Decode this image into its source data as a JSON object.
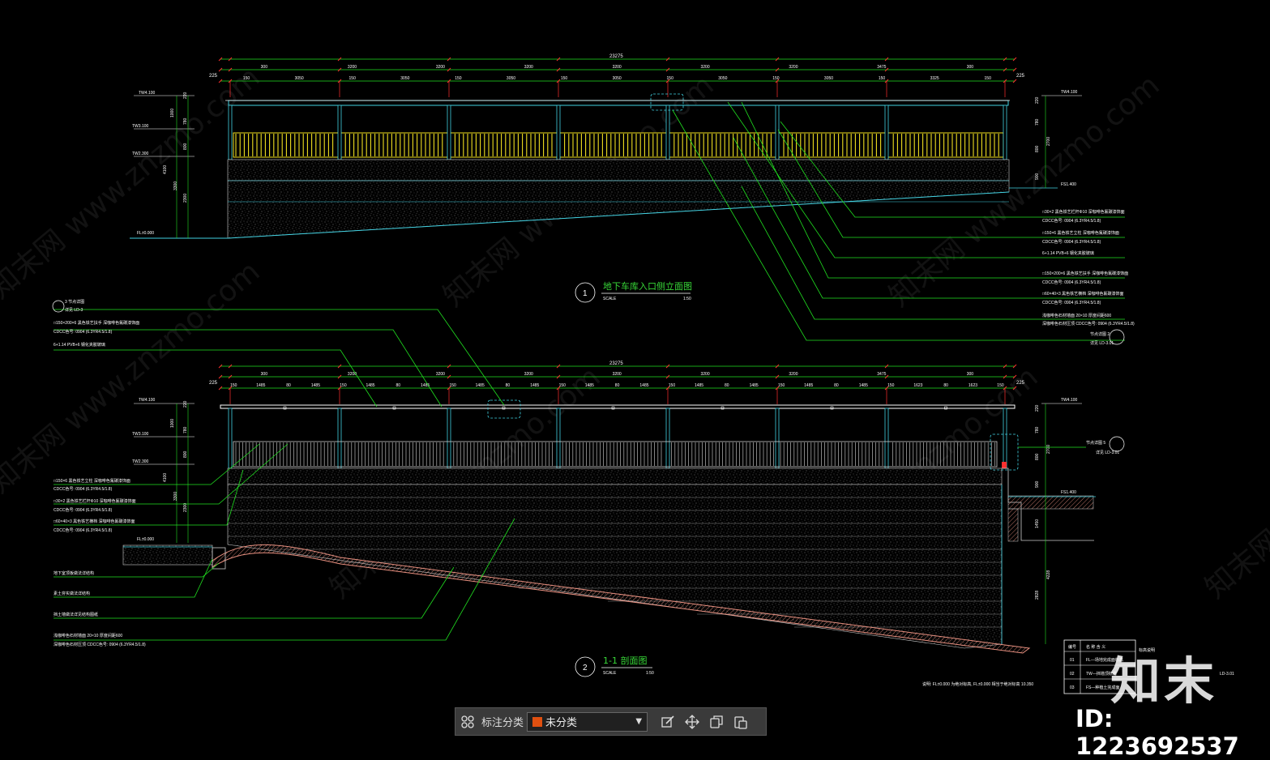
{
  "drawing": {
    "top_view": {
      "title": "地下车库入口侧立面图",
      "number": "1",
      "scale_left": "SCALE",
      "scale_right": "1:50",
      "overall_dim": "23275",
      "segment_dims": [
        "300",
        "3200",
        "3200",
        "3200",
        "3200",
        "3200",
        "3200",
        "3475",
        "300"
      ],
      "sub_dims": [
        "150",
        "3050",
        "150",
        "3050",
        "150",
        "3050",
        "150",
        "3050",
        "150",
        "3050",
        "150",
        "3050",
        "150",
        "3325",
        "150"
      ],
      "edge_dims": [
        "225",
        "225"
      ],
      "levels_left": [
        "TW4.100",
        "TW3.100",
        "TW2.300",
        "FL±0.000"
      ],
      "levels_right": [
        "TW4.100",
        "FS1.400"
      ],
      "vdims_left": [
        "1000",
        "4100",
        "3300",
        "2300",
        "800",
        "780",
        "220"
      ],
      "vdims_right": [
        "220",
        "780",
        "800",
        "2700",
        "900"
      ],
      "callouts": [
        "□30×2 黑色铁艺栏杆Φ10  深咖啡色氟碳漆饰面",
        "CDCC色号: 0904 (6.3YR4.5/1.8)",
        "□150×6 黑色铁艺立柱  深咖啡色氟碳漆饰面",
        "CDCC色号: 0904 (6.3YR4.5/1.8)",
        "6+1.14 PVB+6 钢化夹胶玻璃",
        "□150×200×6 黑色铁艺扶手  深咖啡色氟碳漆饰面",
        "CDCC色号: 0904 (6.3YR4.5/1.8)",
        "□60×40×3 黑色铁艺横档  深咖啡色氟碳漆饰面",
        "CDCC色号: 0904 (6.3YR4.5/1.8)",
        "浅咖啡色石材墙面 20×10 厚度间距600",
        "深咖啡色石材压顶  CDCC色号: 0904 (6.3YR4.5/1.8)",
        "节点详图 2",
        "详见 LD-3.01"
      ]
    },
    "bottom_view": {
      "title": "1-1 剖面图",
      "number": "2",
      "scale_left": "SCALE",
      "scale_right": "1:50",
      "overall_dim": "23275",
      "segment_dims": [
        "300",
        "3200",
        "3200",
        "3200",
        "3200",
        "3200",
        "3200",
        "3475",
        "300"
      ],
      "sub_dims": [
        "150",
        "1485",
        "80",
        "1485",
        "150",
        "1485",
        "80",
        "1485",
        "150",
        "1485",
        "80",
        "1485",
        "150",
        "1485",
        "80",
        "1485",
        "150",
        "1485",
        "80",
        "1485",
        "150",
        "1485",
        "80",
        "1485",
        "150",
        "1623",
        "80",
        "1623",
        "150"
      ],
      "edge_dims": [
        "225",
        "225"
      ],
      "levels_left": [
        "TW4.100",
        "TW3.100",
        "TW2.300",
        "FL±0.000"
      ],
      "levels_right": [
        "TW4.100",
        "FS1.400"
      ],
      "vdims_left": [
        "1000",
        "4100",
        "3300",
        "2300",
        "800",
        "780",
        "220"
      ],
      "vdims_right": [
        "220",
        "780",
        "800",
        "2700",
        "900",
        "1450",
        "4228",
        "2828"
      ],
      "callouts_left_top": [
        "3 节点详图",
        "详见 LD-3",
        "□150×200×6 黑色铁艺扶手  深咖啡色氟碳漆饰面",
        "CDCC色号: 0904 (6.3YR4.5/1.8)",
        "6+1.14 PVB+6 钢化夹胶玻璃"
      ],
      "callouts_left_bottom": [
        "□150×6 黑色铁艺立柱  深咖啡色氟碳漆饰面",
        "CDCC色号: 0904 (6.3YR4.5/1.8)",
        "□30×2 黑色铁艺栏杆Φ10  深咖啡色氟碳漆饰面",
        "CDCC色号: 0904 (6.3YR4.5/1.8)",
        "□60×40×3 黑色铁艺横档  深咖啡色氟碳漆饰面",
        "CDCC色号: 0904 (6.3YR4.5/1.8)",
        "地下室顶板做法详结构",
        "素土夯实做法详结构",
        "挡土墙做法详见结构图纸",
        "浅咖啡色石材墙面 20×10 厚度间距600",
        "深咖啡色石材压顶  CDCC色号: 0904 (6.3YR4.5/1.8)"
      ],
      "callout_right": [
        "节点详图 5",
        "详见 LD-3.01"
      ]
    },
    "legend": {
      "header": [
        "编号",
        "名  称  含  义"
      ],
      "rows": [
        [
          "01",
          "FL—场地完成面标高"
        ],
        [
          "02",
          "TW—挡墙顶标高"
        ],
        [
          "03",
          "FS—种植土完成面"
        ]
      ],
      "caption": "标高说明"
    },
    "note": "说明: FL±0.000 为绝对标高, FL±0.000 相当于绝对标高 10.350",
    "sheet": "LD-3.01",
    "watermark": "知末网 www.znzmo.com",
    "colors": {
      "background": "#000000",
      "cyan": "#40d0e0",
      "yellow": "#f0e020",
      "green": "#20e020",
      "red": "#ff3030",
      "white": "#ffffff",
      "salmon": "#e89080"
    }
  },
  "toolbar": {
    "label": "标注分类",
    "select_value": "未分类",
    "swatch_color": "#e05010",
    "icons": [
      "grid-icon",
      "edit-icon",
      "move-icon",
      "copy-icon",
      "paste-icon"
    ]
  },
  "brand": {
    "logo": "知末",
    "id": "ID: 1223692537"
  }
}
